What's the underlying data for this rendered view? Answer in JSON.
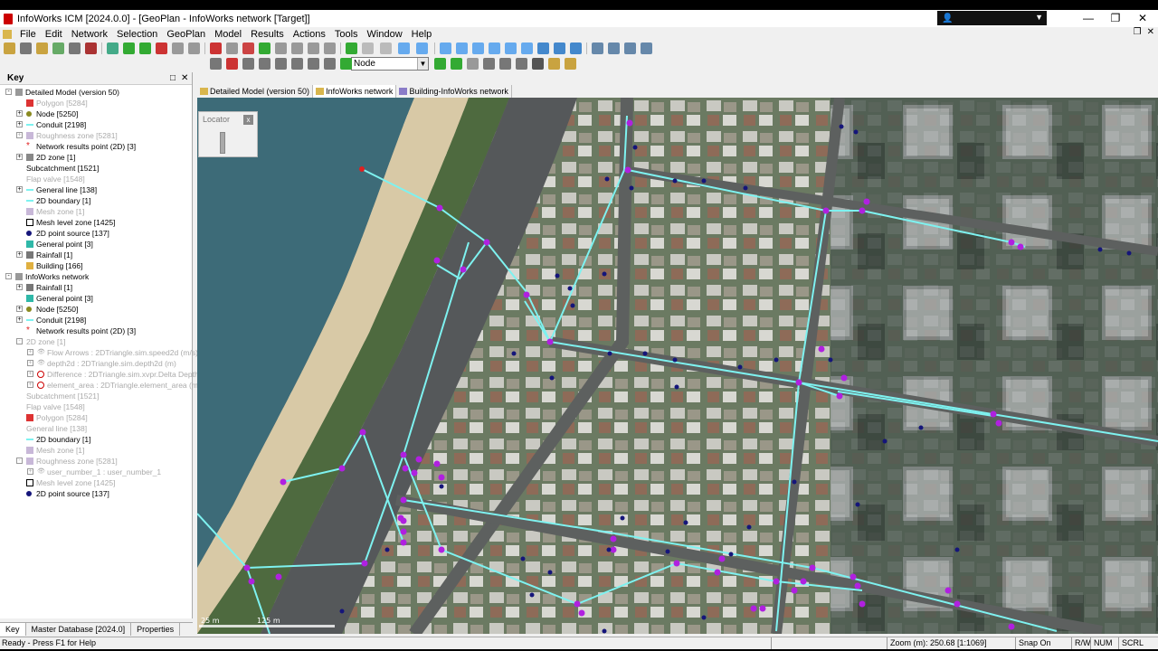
{
  "window": {
    "title": "InfoWorks ICM [2024.0.0] - [GeoPlan - InfoWorks network [Target]]",
    "minimize": "—",
    "restore": "❐",
    "close": "✕"
  },
  "menu": {
    "items": [
      {
        "label": "File"
      },
      {
        "label": "Edit"
      },
      {
        "label": "Network"
      },
      {
        "label": "Selection"
      },
      {
        "label": "GeoPlan"
      },
      {
        "label": "Model"
      },
      {
        "label": "Results"
      },
      {
        "label": "Actions"
      },
      {
        "label": "Tools"
      },
      {
        "label": "Window"
      },
      {
        "label": "Help"
      }
    ]
  },
  "toolbar": {
    "node_select_value": "Node"
  },
  "key_panel": {
    "title": "Key",
    "pin": "□",
    "close": "✕",
    "rows": [
      {
        "label": "Detailed Model (version 50)",
        "level": 0,
        "expander": "-",
        "dim": false,
        "icon": "model"
      },
      {
        "label": "Polygon [5284]",
        "level": 1,
        "expander": "",
        "dim": true,
        "icon": "polygon"
      },
      {
        "label": "Node [5250]",
        "level": 1,
        "expander": "+",
        "dim": false,
        "icon": "node"
      },
      {
        "label": "Conduit [2198]",
        "level": 1,
        "expander": "+",
        "dim": false,
        "icon": "conduit"
      },
      {
        "label": "Roughness zone [5281]",
        "level": 1,
        "expander": "+",
        "dim": true,
        "icon": "zone"
      },
      {
        "label": "Network results point (2D) [3]",
        "level": 1,
        "expander": "",
        "dim": false,
        "icon": "star"
      },
      {
        "label": "2D zone [1]",
        "level": 1,
        "expander": "+",
        "dim": false,
        "icon": "hatch"
      },
      {
        "label": "Subcatchment [1521]",
        "level": 1,
        "expander": "",
        "dim": false,
        "icon": "none"
      },
      {
        "label": "Flap valve [1548]",
        "level": 1,
        "expander": "",
        "dim": true,
        "icon": "none"
      },
      {
        "label": "General line [138]",
        "level": 1,
        "expander": "+",
        "dim": false,
        "icon": "line"
      },
      {
        "label": "2D boundary [1]",
        "level": 1,
        "expander": "",
        "dim": false,
        "icon": "line"
      },
      {
        "label": "Mesh zone [1]",
        "level": 1,
        "expander": "",
        "dim": true,
        "icon": "mesh"
      },
      {
        "label": "Mesh level zone [1425]",
        "level": 1,
        "expander": "",
        "dim": false,
        "icon": "box"
      },
      {
        "label": "2D point source [137]",
        "level": 1,
        "expander": "",
        "dim": false,
        "icon": "dot"
      },
      {
        "label": "General point [3]",
        "level": 1,
        "expander": "",
        "dim": false,
        "icon": "square"
      },
      {
        "label": "Rainfall [1]",
        "level": 1,
        "expander": "+",
        "dim": false,
        "icon": "rain"
      },
      {
        "label": "Building [166]",
        "level": 1,
        "expander": "",
        "dim": false,
        "icon": "building"
      },
      {
        "label": "InfoWorks network",
        "level": 0,
        "expander": "-",
        "dim": false,
        "icon": "model"
      },
      {
        "label": "Rainfall [1]",
        "level": 1,
        "expander": "+",
        "dim": false,
        "icon": "rain"
      },
      {
        "label": "General point [3]",
        "level": 1,
        "expander": "",
        "dim": false,
        "icon": "square"
      },
      {
        "label": "Node [5250]",
        "level": 1,
        "expander": "+",
        "dim": false,
        "icon": "node"
      },
      {
        "label": "Conduit [2198]",
        "level": 1,
        "expander": "+",
        "dim": false,
        "icon": "conduit"
      },
      {
        "label": "Network results point (2D) [3]",
        "level": 1,
        "expander": "",
        "dim": false,
        "icon": "star"
      },
      {
        "label": "2D zone [1]",
        "level": 1,
        "expander": "-",
        "dim": true,
        "icon": "none"
      },
      {
        "label": "Flow Arrows : 2DTriangle.sim.speed2d (m/s)",
        "level": 2,
        "expander": "+",
        "dim": true,
        "icon": "eye"
      },
      {
        "label": "depth2d : 2DTriangle.sim.depth2d (m)",
        "level": 2,
        "expander": "+",
        "dim": true,
        "icon": "eye"
      },
      {
        "label": "Difference : 2DTriangle.sim.xvpr.Delta Depth",
        "level": 2,
        "expander": "+",
        "dim": true,
        "icon": "no"
      },
      {
        "label": "element_area : 2DTriangle.element_area (m2)",
        "level": 2,
        "expander": "+",
        "dim": true,
        "icon": "no"
      },
      {
        "label": "Subcatchment [1521]",
        "level": 1,
        "expander": "",
        "dim": true,
        "icon": "none"
      },
      {
        "label": "Flap valve [1548]",
        "level": 1,
        "expander": "",
        "dim": true,
        "icon": "none"
      },
      {
        "label": "Polygon [5284]",
        "level": 1,
        "expander": "",
        "dim": true,
        "icon": "polygon"
      },
      {
        "label": "General line [138]",
        "level": 1,
        "expander": "",
        "dim": true,
        "icon": "none"
      },
      {
        "label": "2D boundary [1]",
        "level": 1,
        "expander": "",
        "dim": false,
        "icon": "line"
      },
      {
        "label": "Mesh zone [1]",
        "level": 1,
        "expander": "",
        "dim": true,
        "icon": "mesh"
      },
      {
        "label": "Roughness zone [5281]",
        "level": 1,
        "expander": "-",
        "dim": true,
        "icon": "zone"
      },
      {
        "label": "user_number_1 : user_number_1",
        "level": 2,
        "expander": "+",
        "dim": true,
        "icon": "eye"
      },
      {
        "label": "Mesh level zone [1425]",
        "level": 1,
        "expander": "",
        "dim": true,
        "icon": "box"
      },
      {
        "label": "2D point source [137]",
        "level": 1,
        "expander": "",
        "dim": false,
        "icon": "dot"
      }
    ]
  },
  "panel_tabs": [
    {
      "label": "Key",
      "active": true
    },
    {
      "label": "Master Database [2024.0]",
      "active": false
    },
    {
      "label": "Properties",
      "active": false
    }
  ],
  "doc_tabs": [
    {
      "label": "Detailed Model (version 50)",
      "active": false
    },
    {
      "label": "InfoWorks network",
      "active": true
    },
    {
      "label": "Building-InfoWorks network",
      "active": false
    }
  ],
  "locator": {
    "title": "Locator",
    "close": "x"
  },
  "map": {
    "scale_label_left": "25 m",
    "scale_label_right": "125 m"
  },
  "status": {
    "ready": "Ready - Press F1 for Help",
    "zoom": "Zoom (m): 250.68 [1:1069]",
    "snap": "Snap On",
    "rw": "R/W",
    "num": "NUM",
    "scrl": "SCRL"
  },
  "colors": {
    "pipe": "#7ef2f0",
    "node": "#b020e0",
    "point_source": "#15157a",
    "results_point": "#e02020"
  }
}
